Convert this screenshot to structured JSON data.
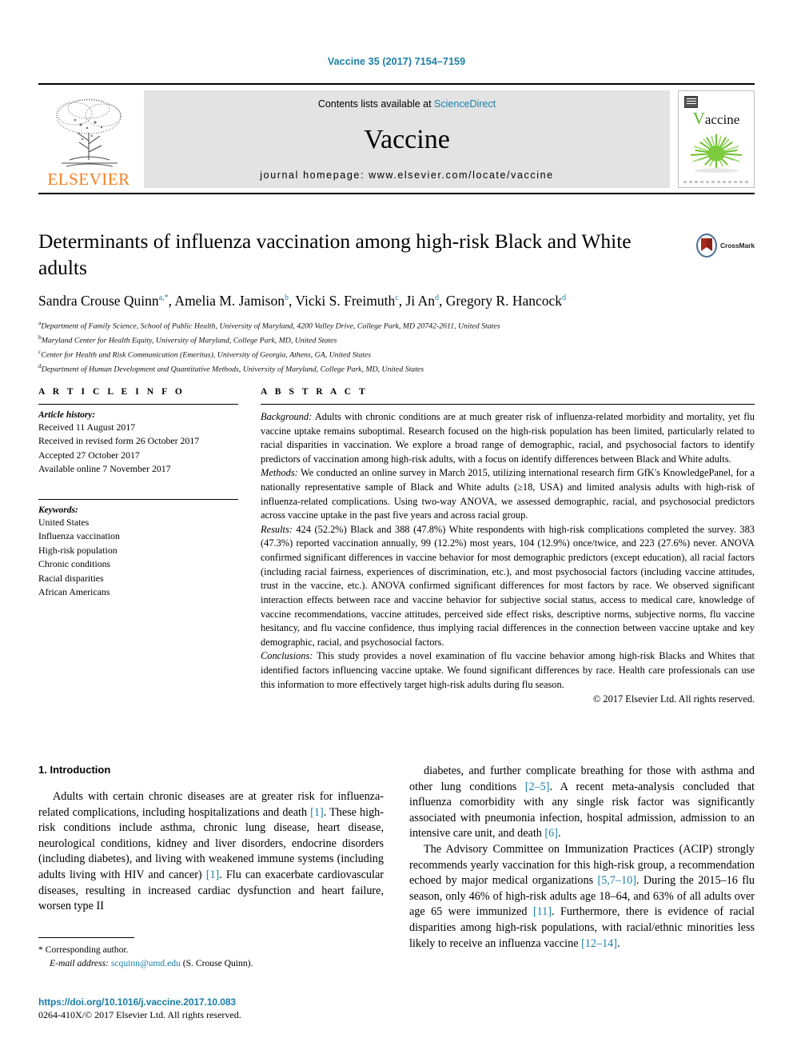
{
  "running_head": "Vaccine 35 (2017) 7154–7159",
  "masthead": {
    "contents_prefix": "Contents lists available at ",
    "contents_link": "ScienceDirect",
    "journal_name": "Vaccine",
    "homepage": "journal homepage: www.elsevier.com/locate/vaccine",
    "publisher_logo_text": "ELSEVIER",
    "cover_title_first_letter": "V",
    "cover_title_rest": "accine"
  },
  "article": {
    "title": "Determinants of influenza vaccination among high-risk Black and White adults",
    "crossmark_label": "CrossMark",
    "authors_html": "Sandra Crouse Quinn<sup>a,*</sup>, Amelia M. Jamison<sup>b</sup>, Vicki S. Freimuth<sup>c</sup>, Ji An<sup>d</sup>, Gregory R. Hancock<sup>d</sup>",
    "affiliations": [
      {
        "marker": "a",
        "text": "Department of Family Science, School of Public Health, University of Maryland, 4200 Valley Drive, College Park, MD 20742-2611, United States"
      },
      {
        "marker": "b",
        "text": "Maryland Center for Health Equity, University of Maryland, College Park, MD, United States"
      },
      {
        "marker": "c",
        "text": "Center for Health and Risk Communication (Emeritus), University of Georgia, Athens, GA, United States"
      },
      {
        "marker": "d",
        "text": "Department of Human Development and Quantitative Methods, University of Maryland, College Park, MD, United States"
      }
    ]
  },
  "article_info": {
    "heading": "A R T I C L E   I N F O",
    "history_label": "Article history:",
    "history": [
      "Received 11 August 2017",
      "Received in revised form 26 October 2017",
      "Accepted 27 October 2017",
      "Available online 7 November 2017"
    ],
    "keywords_label": "Keywords:",
    "keywords": [
      "United States",
      "Influenza vaccination",
      "High-risk population",
      "Chronic conditions",
      "Racial disparities",
      "African Americans"
    ]
  },
  "abstract": {
    "heading": "A B S T R A C T",
    "sections": [
      {
        "label": "Background:",
        "text": " Adults with chronic conditions are at much greater risk of influenza-related morbidity and mortality, yet flu vaccine uptake remains suboptimal. Research focused on the high-risk population has been limited, particularly related to racial disparities in vaccination. We explore a broad range of demographic, racial, and psychosocial factors to identify predictors of vaccination among high-risk adults, with a focus on identify differences between Black and White adults."
      },
      {
        "label": "Methods:",
        "text": " We conducted an online survey in March 2015, utilizing international research firm GfK's KnowledgePanel, for a nationally representative sample of Black and White adults (≥18, USA) and limited analysis adults with high-risk of influenza-related complications. Using two-way ANOVA, we assessed demographic, racial, and psychosocial predictors across vaccine uptake in the past five years and across racial group."
      },
      {
        "label": "Results:",
        "text": " 424 (52.2%) Black and 388 (47.8%) White respondents with high-risk complications completed the survey. 383 (47.3%) reported vaccination annually, 99 (12.2%) most years, 104 (12.9%) once/twice, and 223 (27.6%) never. ANOVA confirmed significant differences in vaccine behavior for most demographic predictors (except education), all racial factors (including racial fairness, experiences of discrimination, etc.), and most psychosocial factors (including vaccine attitudes, trust in the vaccine, etc.). ANOVA confirmed significant differences for most factors by race. We observed significant interaction effects between race and vaccine behavior for subjective social status, access to medical care, knowledge of vaccine recommendations, vaccine attitudes, perceived side effect risks, descriptive norms, subjective norms, flu vaccine hesitancy, and flu vaccine confidence, thus implying racial differences in the connection between vaccine uptake and key demographic, racial, and psychosocial factors."
      },
      {
        "label": "Conclusions:",
        "text": " This study provides a novel examination of flu vaccine behavior among high-risk Blacks and Whites that identified factors influencing vaccine uptake. We found significant differences by race. Health care professionals can use this information to more effectively target high-risk adults during flu season."
      }
    ],
    "copyright": "© 2017 Elsevier Ltd. All rights reserved."
  },
  "introduction": {
    "heading": "1. Introduction",
    "left_paragraph_html": "Adults with certain chronic diseases are at greater risk for influenza-related complications, including hospitalizations and death <span class=\"ref\">[1]</span>. These high-risk conditions include asthma, chronic lung disease, heart disease, neurological conditions, kidney and liver disorders, endocrine disorders (including diabetes), and living with weakened immune systems (including adults living with HIV and cancer) <span class=\"ref\">[1]</span>. Flu can exacerbate cardiovascular diseases, resulting in increased cardiac dysfunction and heart failure, worsen type II",
    "right_paragraph_1_html": "diabetes, and further complicate breathing for those with asthma and other lung conditions <span class=\"ref\">[2–5]</span>. A recent meta-analysis concluded that influenza comorbidity with any single risk factor was significantly associated with pneumonia infection, hospital admission, admission to an intensive care unit, and death <span class=\"ref\">[6]</span>.",
    "right_paragraph_2_html": "The Advisory Committee on Immunization Practices (ACIP) strongly recommends yearly vaccination for this high-risk group, a recommendation echoed by major medical organizations <span class=\"ref\">[5,7–10]</span>. During the 2015–16 flu season, only 46% of high-risk adults age 18–64, and 63% of all adults over age 65 were immunized <span class=\"ref\">[11]</span>. Furthermore, there is evidence of racial disparities among high-risk populations, with racial/ethnic minorities less likely to receive an influenza vaccine <span class=\"ref\">[12–14]</span>."
  },
  "footer": {
    "corresponding_author": "Corresponding author.",
    "email_label": "E-mail address:",
    "email": "scquinn@umd.edu",
    "email_suffix": "(S. Crouse Quinn).",
    "doi": "https://doi.org/10.1016/j.vaccine.2017.10.083",
    "issn_line": "0264-410X/© 2017 Elsevier Ltd. All rights reserved."
  },
  "colors": {
    "link": "#1a7fa8",
    "elsevier_orange": "#f57f20",
    "band_gray": "#e3e3e3",
    "vaccine_green": "#5fb529",
    "crossmark_red": "#a52a1e"
  }
}
